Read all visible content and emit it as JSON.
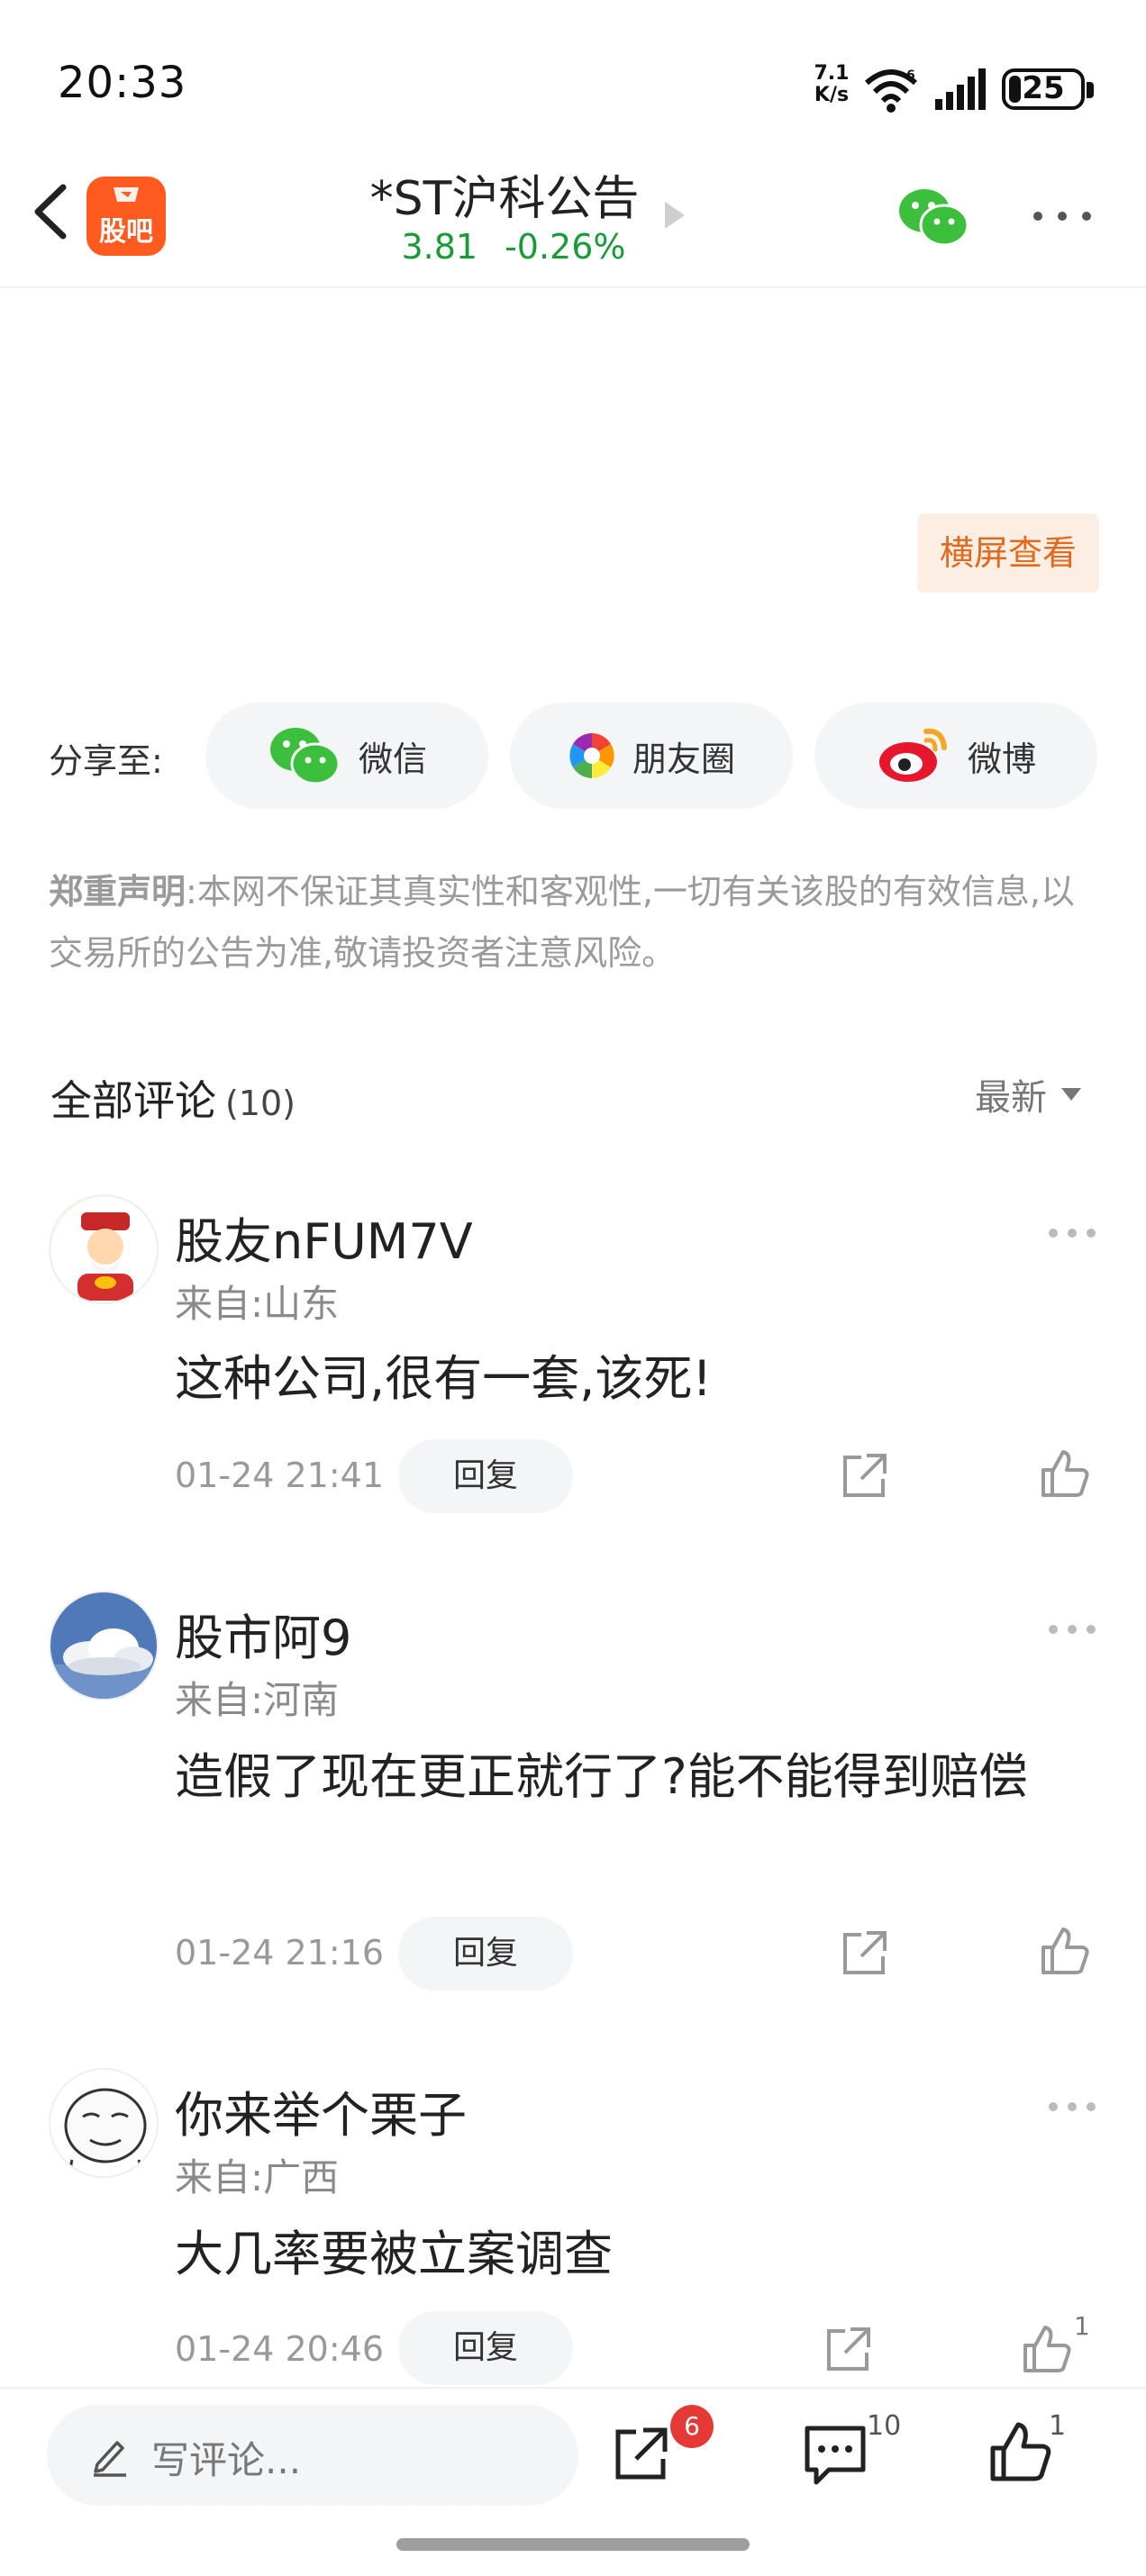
{
  "status_bar": {
    "time": "20:33",
    "net_speed_value": "7.1",
    "net_speed_unit": "K/s",
    "battery": "25",
    "battery_level": 0.25
  },
  "header": {
    "app_logo_text": "股吧",
    "title": "*ST沪科公告",
    "price": "3.81",
    "change": "-0.26%",
    "price_color": "#1a9a38"
  },
  "landscape_label": "横屏查看",
  "share": {
    "label": "分享至:",
    "wechat": "微信",
    "moments": "朋友圈",
    "weibo": "微博"
  },
  "disclaimer": {
    "title": "郑重声明",
    "text": ":本网不保证其真实性和客观性,一切有关该股的有效信息,以交易所的公告为准,敬请投资者注意风险。"
  },
  "comments_section": {
    "title": "全部评论",
    "count": "(10)",
    "sort": "最新"
  },
  "comments": [
    {
      "username": "股友nFUM7V",
      "location": "来自:山东",
      "content": "这种公司,很有一套,该死!",
      "time": "01-24 21:41",
      "reply": "回复",
      "likes": ""
    },
    {
      "username": "股市阿9",
      "location": "来自:河南",
      "content": "造假了现在更正就行了?能不能得到赔偿",
      "time": "01-24 21:16",
      "reply": "回复",
      "likes": ""
    },
    {
      "username": "你来举个栗子",
      "location": "来自:广西",
      "content": "大几率要被立案调查",
      "time": "01-24 20:46",
      "reply": "回复",
      "likes": "1"
    }
  ],
  "bottom_bar": {
    "input_placeholder": "写评论...",
    "share_badge": "6",
    "comment_count": "10",
    "like_count": "1"
  },
  "colors": {
    "brand_orange": "#ff5a1f",
    "price_green": "#1a9a38",
    "badge_red": "#e53935"
  }
}
